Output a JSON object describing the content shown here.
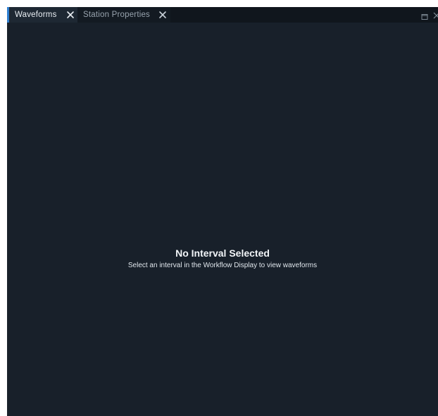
{
  "tabs": [
    {
      "label": "Waveforms",
      "active": true,
      "close_icon": "close-icon"
    },
    {
      "label": "Station Properties",
      "active": false,
      "close_icon": "close-icon"
    }
  ],
  "window_controls": {
    "maximize_icon": "maximize-icon",
    "close_icon": "close-icon"
  },
  "empty_state": {
    "title": "No Interval Selected",
    "description": "Select an interval in the Workflow Display to view waveforms"
  },
  "colors": {
    "background": "#18202a",
    "tabbar": "#10161d",
    "active_tab": "#1e2833",
    "accent": "#2f7fd1",
    "text_primary": "#f2f5f8",
    "text_muted": "#98a3ae"
  }
}
